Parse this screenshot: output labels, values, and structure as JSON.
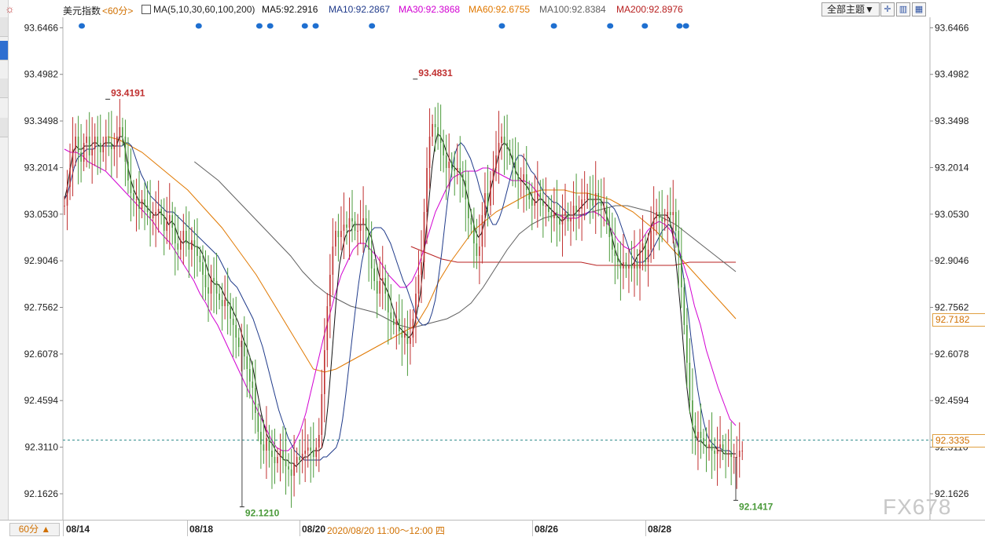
{
  "topbar": {
    "symbol": "美元指数",
    "period": "<60分>",
    "ma_header": "MA(5,10,30,60,100,200)",
    "ma_values": [
      {
        "label": "MA5:92.2916",
        "color": "#111111"
      },
      {
        "label": "MA10:92.2867",
        "color": "#1f3a8a"
      },
      {
        "label": "MA30:92.3868",
        "color": "#d200d2"
      },
      {
        "label": "MA60:92.6755",
        "color": "#e07800"
      },
      {
        "label": "MA100:92.8384",
        "color": "#606060"
      },
      {
        "label": "MA200:92.8976",
        "color": "#b82020"
      }
    ],
    "theme_button": "全部主题▼"
  },
  "bottombar": {
    "period_button": "60分 ▲",
    "dates": [
      "08/14",
      "08/18",
      "08/20",
      "08/26",
      "08/28"
    ],
    "cursor_time": "2020/08/20 11:00～12:00 四"
  },
  "watermark": "FX678",
  "colors": {
    "up": "#c03030",
    "down": "#4a9a3a",
    "grid": "#d0d0d0",
    "current_line": "#2b8a8a",
    "accent": "#d07000"
  },
  "chart_data": {
    "type": "candlestick",
    "y_ticks": [
      "93.6466",
      "93.4982",
      "93.3498",
      "93.2014",
      "93.0530",
      "92.9046",
      "92.7562",
      "92.6078",
      "92.4594",
      "92.3110",
      "92.1626"
    ],
    "ylim": [
      92.08,
      93.68
    ],
    "highlight_prices": [
      "92.7182",
      "92.3335"
    ],
    "current_price": 92.3335,
    "annotations": [
      {
        "text": "93.4191",
        "type": "high",
        "bar": 20
      },
      {
        "text": "93.4831",
        "type": "high",
        "bar": 162
      },
      {
        "text": "92.1210",
        "type": "low",
        "bar": 82
      },
      {
        "text": "92.1417",
        "type": "low",
        "bar": 310
      }
    ],
    "event_marker_bars": [
      8,
      62,
      90,
      95,
      111,
      116,
      142,
      202,
      226,
      252,
      268,
      284,
      287
    ],
    "closes": [
      93.08,
      93.14,
      93.2,
      93.26,
      93.3,
      93.25,
      93.22,
      93.28,
      93.3,
      93.24,
      93.26,
      93.3,
      93.28,
      93.25,
      93.27,
      93.3,
      93.28,
      93.26,
      93.27,
      93.3,
      93.33,
      93.3,
      93.22,
      93.16,
      93.12,
      93.1,
      93.1,
      93.07,
      93.1,
      93.08,
      93.06,
      93.04,
      93.05,
      93.06,
      93.07,
      93.05,
      93.0,
      93.03,
      93.05,
      93.01,
      92.96,
      92.94,
      92.97,
      93.0,
      92.96,
      92.94,
      92.97,
      92.95,
      92.92,
      92.9,
      92.86,
      92.82,
      92.8,
      92.85,
      92.84,
      92.8,
      92.78,
      92.76,
      92.78,
      92.76,
      92.72,
      92.7,
      92.66,
      92.63,
      92.65,
      92.6,
      92.56,
      92.52,
      92.5,
      92.42,
      92.36,
      92.32,
      92.3,
      92.34,
      92.3,
      92.28,
      92.26,
      92.28,
      92.3,
      92.27,
      92.25,
      92.24,
      92.22,
      92.26,
      92.28,
      92.27,
      92.29,
      92.3,
      92.31,
      92.3,
      92.28,
      92.31,
      92.35,
      92.48,
      92.62,
      92.76,
      92.86,
      92.95,
      93.0,
      92.98,
      93.0,
      93.02,
      93.01,
      93.04,
      93.03,
      93.0,
      93.0,
      93.02,
      93.04,
      93.0,
      92.94,
      92.88,
      92.84,
      92.8,
      92.84,
      92.85,
      92.8,
      92.74,
      92.72,
      92.7,
      92.72,
      92.68,
      92.66,
      92.68,
      92.64,
      92.66,
      92.72,
      92.8,
      92.86,
      92.9,
      93.06,
      93.2,
      93.3,
      93.34,
      93.33,
      93.3,
      93.28,
      93.24,
      93.2,
      93.22,
      93.2,
      93.19,
      93.2,
      93.18,
      93.16,
      93.1,
      93.04,
      93.02,
      92.96,
      92.92,
      92.95,
      93.05,
      93.12,
      93.08,
      93.16,
      93.2,
      93.24,
      93.28,
      93.3,
      93.28,
      93.26,
      93.24,
      93.22,
      93.18,
      93.16,
      93.16,
      93.18,
      93.13,
      93.1,
      93.08,
      93.1,
      93.12,
      93.1,
      93.08,
      93.08,
      93.06,
      93.04,
      93.06,
      93.04,
      93.02,
      93.05,
      93.06,
      93.03,
      93.04,
      93.08,
      93.06,
      93.07,
      93.1,
      93.1,
      93.12,
      93.1,
      93.08,
      93.12,
      93.1,
      93.08,
      93.08,
      93.02,
      92.98,
      92.94,
      92.92,
      92.9,
      92.88,
      92.9,
      92.88,
      92.89,
      92.88,
      92.9,
      92.88,
      92.94,
      92.96,
      92.9,
      92.94,
      93.0,
      93.04,
      93.06,
      93.04,
      93.03,
      93.04,
      93.06,
      93.05,
      93.06,
      93.0,
      92.92,
      92.82,
      92.7,
      92.58,
      92.46,
      92.38,
      92.34,
      92.36,
      92.34,
      92.32,
      92.31,
      92.32,
      92.3,
      92.29,
      92.31,
      92.32,
      92.3,
      92.29,
      92.29,
      92.28,
      92.28,
      92.28,
      92.3,
      92.3
    ],
    "ma5": [
      93.1,
      93.14,
      93.2,
      93.25,
      93.27,
      93.26,
      93.26,
      93.27,
      93.27,
      93.27,
      93.28,
      93.28,
      93.27,
      93.27,
      93.28,
      93.28,
      93.28,
      93.27,
      93.27,
      93.3,
      93.3,
      93.26,
      93.2,
      93.16,
      93.13,
      93.11,
      93.09,
      93.09,
      93.08,
      93.07,
      93.06,
      93.05,
      93.05,
      93.06,
      93.05,
      93.04,
      93.02,
      93.03,
      93.02,
      92.99,
      92.97,
      92.96,
      92.97,
      92.96,
      92.96,
      92.95,
      92.95,
      92.94,
      92.92,
      92.89,
      92.86,
      92.84,
      92.83,
      92.83,
      92.82,
      92.8,
      92.78,
      92.77,
      92.75,
      92.73,
      92.71,
      92.68,
      92.65,
      92.63,
      92.6,
      92.57,
      92.52,
      92.47,
      92.42,
      92.38,
      92.35,
      92.33,
      92.32,
      92.3,
      92.29,
      92.28,
      92.27,
      92.27,
      92.26,
      92.26,
      92.25,
      92.26,
      92.27,
      92.28,
      92.28,
      92.29,
      92.3,
      92.3,
      92.3,
      92.31,
      92.35,
      92.44,
      92.55,
      92.67,
      92.79,
      92.89,
      92.94,
      92.98,
      93.0,
      93.0,
      93.02,
      93.02,
      93.02,
      93.02,
      93.02,
      93.0,
      92.98,
      92.94,
      92.89,
      92.85,
      92.84,
      92.82,
      92.8,
      92.77,
      92.74,
      92.71,
      92.69,
      92.68,
      92.67,
      92.66,
      92.67,
      92.7,
      92.75,
      92.8,
      92.89,
      93.0,
      93.1,
      93.2,
      93.27,
      93.31,
      93.3,
      93.28,
      93.25,
      93.23,
      93.21,
      93.2,
      93.19,
      93.18,
      93.16,
      93.12,
      93.08,
      93.04,
      93.0,
      92.98,
      92.99,
      93.02,
      93.07,
      93.12,
      93.16,
      93.2,
      93.24,
      93.27,
      93.28,
      93.27,
      93.25,
      93.22,
      93.19,
      93.17,
      93.16,
      93.15,
      93.14,
      93.12,
      93.1,
      93.09,
      93.1,
      93.1,
      93.09,
      93.08,
      93.07,
      93.06,
      93.05,
      93.04,
      93.03,
      93.04,
      93.05,
      93.05,
      93.05,
      93.06,
      93.07,
      93.08,
      93.09,
      93.1,
      93.1,
      93.1,
      93.1,
      93.1,
      93.09,
      93.06,
      93.03,
      92.99,
      92.95,
      92.92,
      92.9,
      92.89,
      92.89,
      92.89,
      92.89,
      92.9,
      92.92,
      92.93,
      92.94,
      92.96,
      92.99,
      93.02,
      93.04,
      93.05,
      93.05,
      93.05,
      93.05,
      93.04,
      93.0,
      92.93,
      92.84,
      92.74,
      92.62,
      92.51,
      92.43,
      92.38,
      92.35,
      92.33,
      92.33,
      92.32,
      92.31,
      92.31,
      92.31,
      92.31,
      92.3,
      92.3,
      92.29,
      92.29,
      92.29,
      92.29,
      92.29
    ],
    "ma10": [
      93.1,
      93.12,
      93.16,
      93.2,
      93.23,
      93.24,
      93.25,
      93.26,
      93.26,
      93.26,
      93.27,
      93.27,
      93.27,
      93.27,
      93.27,
      93.27,
      93.27,
      93.27,
      93.27,
      93.28,
      93.28,
      93.27,
      93.24,
      93.21,
      93.18,
      93.16,
      93.13,
      93.11,
      93.1,
      93.09,
      93.08,
      93.07,
      93.06,
      93.06,
      93.06,
      93.05,
      93.04,
      93.03,
      93.02,
      93.01,
      93.0,
      92.99,
      92.98,
      92.97,
      92.96,
      92.95,
      92.94,
      92.93,
      92.92,
      92.9,
      92.88,
      92.86,
      92.84,
      92.83,
      92.82,
      92.8,
      92.78,
      92.76,
      92.74,
      92.72,
      92.69,
      92.66,
      92.63,
      92.59,
      92.55,
      92.51,
      92.47,
      92.43,
      92.4,
      92.37,
      92.34,
      92.32,
      92.3,
      92.29,
      92.28,
      92.27,
      92.27,
      92.27,
      92.27,
      92.27,
      92.27,
      92.28,
      92.28,
      92.29,
      92.3,
      92.31,
      92.34,
      92.4,
      92.48,
      92.57,
      92.66,
      92.75,
      92.83,
      92.9,
      92.95,
      92.98,
      93.0,
      93.01,
      93.01,
      93.01,
      93.0,
      92.98,
      92.96,
      92.93,
      92.9,
      92.87,
      92.84,
      92.82,
      92.79,
      92.76,
      92.73,
      92.71,
      92.7,
      92.7,
      92.71,
      92.74,
      92.78,
      92.85,
      92.93,
      93.02,
      93.11,
      93.18,
      93.24,
      93.27,
      93.28,
      93.27,
      93.25,
      93.23,
      93.2,
      93.17,
      93.13,
      93.1,
      93.07,
      93.04,
      93.02,
      93.02,
      93.04,
      93.07,
      93.11,
      93.15,
      93.19,
      93.22,
      93.24,
      93.24,
      93.23,
      93.21,
      93.19,
      93.18,
      93.16,
      93.14,
      93.12,
      93.11,
      93.1,
      93.09,
      93.09,
      93.08,
      93.07,
      93.06,
      93.05,
      93.05,
      93.05,
      93.05,
      93.05,
      93.05,
      93.06,
      93.07,
      93.08,
      93.09,
      93.09,
      93.09,
      93.09,
      93.08,
      93.07,
      93.05,
      93.02,
      92.99,
      92.96,
      92.93,
      92.91,
      92.9,
      92.9,
      92.9,
      92.91,
      92.92,
      92.94,
      92.96,
      92.98,
      93.0,
      93.01,
      93.02,
      93.01,
      92.99,
      92.95,
      92.9,
      92.83,
      92.75,
      92.66,
      92.58,
      92.5,
      92.44,
      92.39,
      92.35,
      92.33,
      92.32,
      92.31,
      92.31,
      92.3,
      92.3,
      92.3,
      92.29,
      92.29
    ],
    "ma30": [
      93.26,
      93.25,
      93.25,
      93.24,
      93.22,
      93.21,
      93.2,
      93.19,
      93.17,
      93.15,
      93.13,
      93.11,
      93.09,
      93.07,
      93.05,
      93.03,
      93.0,
      92.98,
      92.96,
      92.93,
      92.9,
      92.87,
      92.84,
      92.8,
      92.77,
      92.73,
      92.7,
      92.66,
      92.62,
      92.58,
      92.54,
      92.5,
      92.46,
      92.42,
      92.38,
      92.34,
      92.31,
      92.3,
      92.3,
      92.32,
      92.36,
      92.42,
      92.5,
      92.58,
      92.66,
      92.73,
      92.8,
      92.86,
      92.9,
      92.94,
      92.96,
      92.96,
      92.94,
      92.92,
      92.89,
      92.86,
      92.84,
      92.82,
      92.82,
      92.84,
      92.88,
      92.94,
      93.0,
      93.06,
      93.1,
      93.14,
      93.17,
      93.18,
      93.19,
      93.19,
      93.19,
      93.2,
      93.2,
      93.19,
      93.18,
      93.17,
      93.16,
      93.16,
      93.16,
      93.15,
      93.13,
      93.1,
      93.08,
      93.06,
      93.05,
      93.04,
      93.04,
      93.04,
      93.05,
      93.06,
      93.06,
      93.05,
      93.03,
      93.0,
      92.97,
      92.95,
      92.94,
      92.95,
      92.97,
      93.0,
      93.02,
      93.03,
      93.02,
      93.0,
      92.96,
      92.9,
      92.84,
      92.76,
      92.7,
      92.62,
      92.56,
      92.5,
      92.45,
      92.4,
      92.38
    ],
    "ma60": [
      93.3,
      93.29,
      93.27,
      93.25,
      93.22,
      93.19,
      93.16,
      93.13,
      93.09,
      93.05,
      93.01,
      92.96,
      92.91,
      92.86,
      92.8,
      92.74,
      92.68,
      92.62,
      92.56,
      92.55,
      92.56,
      92.58,
      92.6,
      92.62,
      92.64,
      92.66,
      92.68,
      92.7,
      92.76,
      92.84,
      92.9,
      92.95,
      93.0,
      93.03,
      93.06,
      93.08,
      93.1,
      93.12,
      93.13,
      93.13,
      93.13,
      93.12,
      93.12,
      93.11,
      93.1,
      93.08,
      93.06,
      93.03,
      93.0,
      92.96,
      92.92,
      92.88,
      92.84,
      92.8,
      92.76,
      92.72
    ],
    "ma100": [
      93.22,
      93.19,
      93.16,
      93.12,
      93.08,
      93.04,
      93.0,
      92.96,
      92.92,
      92.87,
      92.83,
      92.8,
      92.78,
      92.76,
      92.75,
      92.74,
      92.72,
      92.7,
      92.69,
      92.7,
      92.71,
      92.72,
      92.74,
      92.77,
      92.82,
      92.88,
      92.94,
      92.99,
      93.02,
      93.04,
      93.05,
      93.05,
      93.05,
      93.06,
      93.07,
      93.08,
      93.08,
      93.07,
      93.06,
      93.04,
      93.02,
      92.99,
      92.96,
      92.93,
      92.9,
      92.87
    ],
    "ma200": [
      92.95,
      92.93,
      92.91,
      92.9,
      92.9,
      92.9,
      92.9,
      92.9,
      92.9,
      92.9,
      92.9,
      92.9,
      92.89,
      92.89,
      92.89,
      92.89,
      92.89,
      92.89,
      92.9,
      92.9,
      92.9,
      92.9
    ]
  }
}
